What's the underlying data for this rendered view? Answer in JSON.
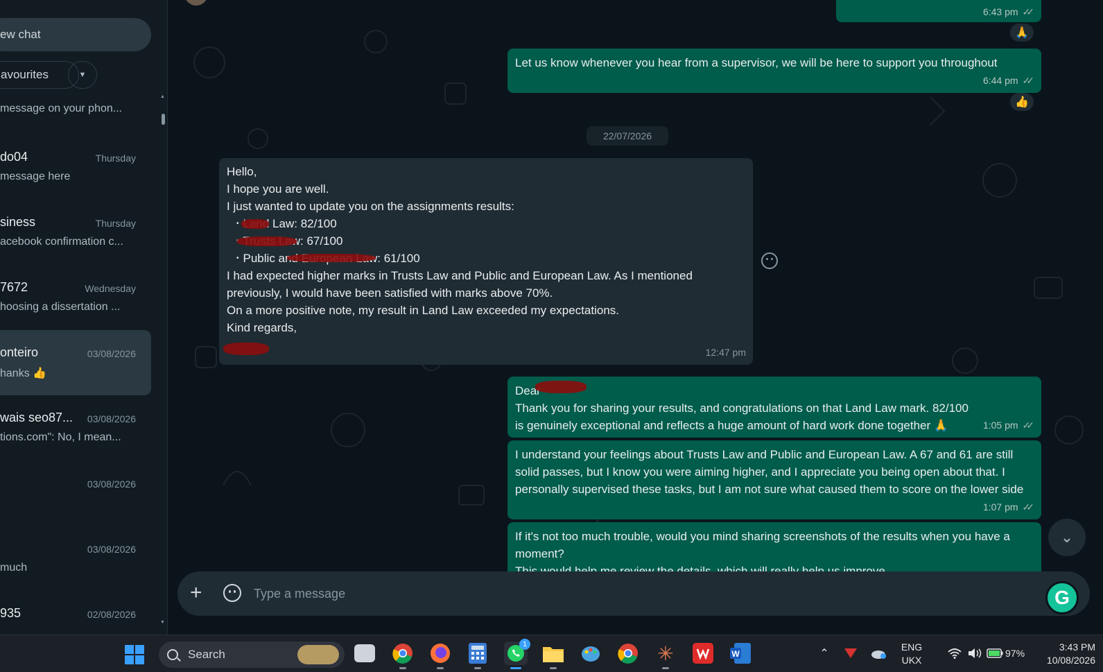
{
  "sidebar": {
    "new_chat_label": "ew chat",
    "filter_label": "avourites",
    "chats": [
      {
        "name": "",
        "time": "",
        "preview": "message on your phon..."
      },
      {
        "name": "do04",
        "time": "Thursday",
        "preview": "message here"
      },
      {
        "name": "siness",
        "time": "Thursday",
        "preview": "acebook confirmation c..."
      },
      {
        "name": " 7672",
        "time": "Wednesday",
        "preview": "hoosing a dissertation ..."
      },
      {
        "name": "onteiro",
        "time": "03/08/2026",
        "preview": "hanks 👍"
      },
      {
        "name": "wais seo87...",
        "time": "03/08/2026",
        "preview": "tions.com\":  No, I mean..."
      },
      {
        "name": "",
        "time": "03/08/2026",
        "preview": ""
      },
      {
        "name": "",
        "time": "03/08/2026",
        "preview": "much"
      },
      {
        "name": "935",
        "time": "02/08/2026",
        "preview": ""
      }
    ]
  },
  "conversation": {
    "messages": {
      "m0_time": "6:43 pm",
      "m0_reaction": "🙏",
      "m1_text": "Let us know whenever you hear from a supervisor, we will be here to support you throughout",
      "m1_time": "6:44 pm",
      "m1_reaction": "👍",
      "date_divider": "22/07/2026",
      "m2_lines": [
        "Hello,",
        "I hope you are well.",
        "I just wanted to update you on the assignments results:"
      ],
      "m2_bullets": [
        "Land Law: 82/100",
        "Trusts Law: 67/100",
        "Public and European Law: 61/100"
      ],
      "m2_para1": "I had expected higher marks in Trusts Law and Public and European Law. As I mentioned previously, I would have been satisfied with marks above 70%.",
      "m2_para2": "On a more positive note, my result in Land Law exceeded my expectations.",
      "m2_para3": "Kind regards,",
      "m2_time": "12:47 pm",
      "m3_greeting": "Dear",
      "m3_text": "Thank you for sharing your results, and congratulations on that Land Law mark. 82/100 is genuinely exceptional and reflects a huge amount of hard work done together 🙏",
      "m3_time": "1:05 pm",
      "m4_text": "I understand your feelings about Trusts Law and Public and European Law. A 67 and 61 are still solid passes, but I know you were aiming higher, and I appreciate you being open about that.  I personally supervised these tasks, but I am not sure what caused them to score on the lower side",
      "m4_time": "1:07 pm",
      "m5_text": "If it's not too much trouble, would you mind sharing screenshots of the results when you have a moment?",
      "m5_text2": "This would help me review the details, which will really help us improve."
    }
  },
  "composer": {
    "placeholder": "Type a message"
  },
  "taskbar": {
    "search_label": "Search",
    "whatsapp_badge": "1",
    "lang_top": "ENG",
    "lang_bottom": "UKX",
    "battery": "97%",
    "clock_time": "3:43 PM",
    "clock_date": "10/08/2026"
  },
  "colors": {
    "outgoing_bubble": "#005c4b",
    "incoming_bubble": "#202c33",
    "background": "#0b141a",
    "accent": "#15c39a"
  }
}
